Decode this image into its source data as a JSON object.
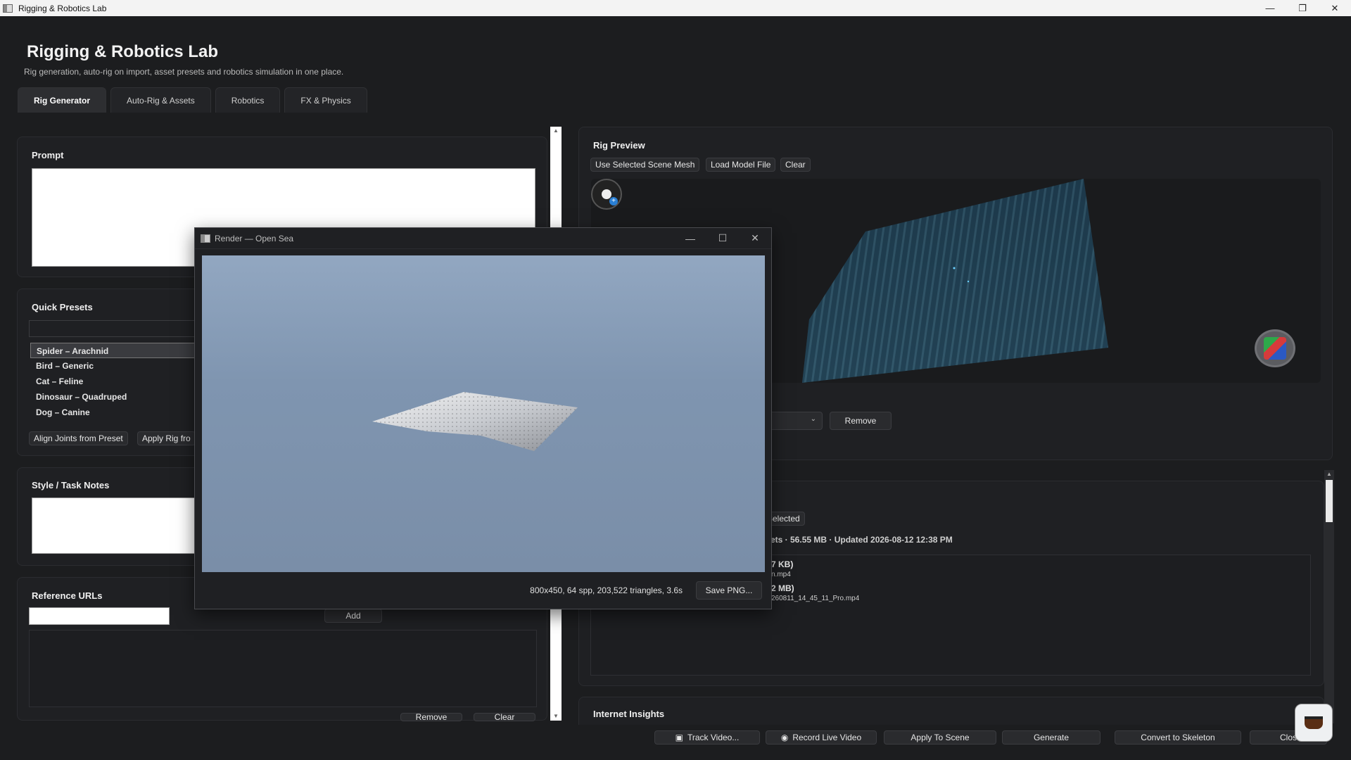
{
  "window": {
    "title": "Rigging & Robotics Lab",
    "minimize": "—",
    "restore": "❐",
    "close": "✕"
  },
  "app": {
    "title": "Rigging & Robotics Lab",
    "subtitle": "Rig generation, auto-rig on import, asset presets and robotics simulation in one place."
  },
  "tabs": [
    {
      "label": "Rig Generator",
      "active": true
    },
    {
      "label": "Auto-Rig & Assets",
      "active": false
    },
    {
      "label": "Robotics",
      "active": false
    },
    {
      "label": "FX & Physics",
      "active": false
    }
  ],
  "prompt": {
    "title": "Prompt",
    "value": ""
  },
  "quick_presets": {
    "title": "Quick Presets",
    "search_value": "",
    "items": [
      {
        "label": "Spider – Arachnid",
        "selected": true
      },
      {
        "label": "Bird – Generic",
        "selected": false
      },
      {
        "label": "Cat – Feline",
        "selected": false
      },
      {
        "label": "Dinosaur – Quadruped",
        "selected": false
      },
      {
        "label": "Dog – Canine",
        "selected": false
      }
    ],
    "align_button": "Align Joints from Preset",
    "apply_button": "Apply Rig fro"
  },
  "style_notes": {
    "title": "Style / Task Notes",
    "value": ""
  },
  "reference_urls": {
    "title": "Reference URLs",
    "input_value": "",
    "add_button": "Add",
    "remove_button": "Remove",
    "clear_button": "Clear"
  },
  "rig_preview": {
    "title": "Rig Preview",
    "use_selected_button": "Use Selected Scene Mesh",
    "load_model_button": "Load Model File",
    "clear_button": "Clear",
    "remove_button": "Remove"
  },
  "assets": {
    "use_selected_fragment": "e Selected",
    "summary_fragment": "ets · 56.55 MB · Updated 2026-08-12 12:38 PM",
    "files": [
      {
        "size_fragment": "7 KB)",
        "name_fragment": "n.mp4"
      },
      {
        "size_fragment": "2 MB)",
        "name_fragment": "260811_14_45_11_Pro.mp4"
      }
    ]
  },
  "internet_insights": {
    "title": "Internet Insights"
  },
  "render_window": {
    "title": "Render — Open Sea",
    "stats": "800x450, 64 spp, 203,522 triangles, 3.6s",
    "save_button": "Save PNG..."
  },
  "bottom_bar": {
    "track_video": "Track Video...",
    "record_live": "Record Live Video",
    "apply_scene": "Apply To Scene",
    "generate": "Generate",
    "convert_skeleton": "Convert to Skeleton",
    "close": "Clos"
  },
  "colors": {
    "background": "#1c1d1f",
    "panel": "#1f2023",
    "accent": "#2a7fd4",
    "sky_top": "#92a7c1",
    "mesh_dark": "#1d3c4e"
  }
}
